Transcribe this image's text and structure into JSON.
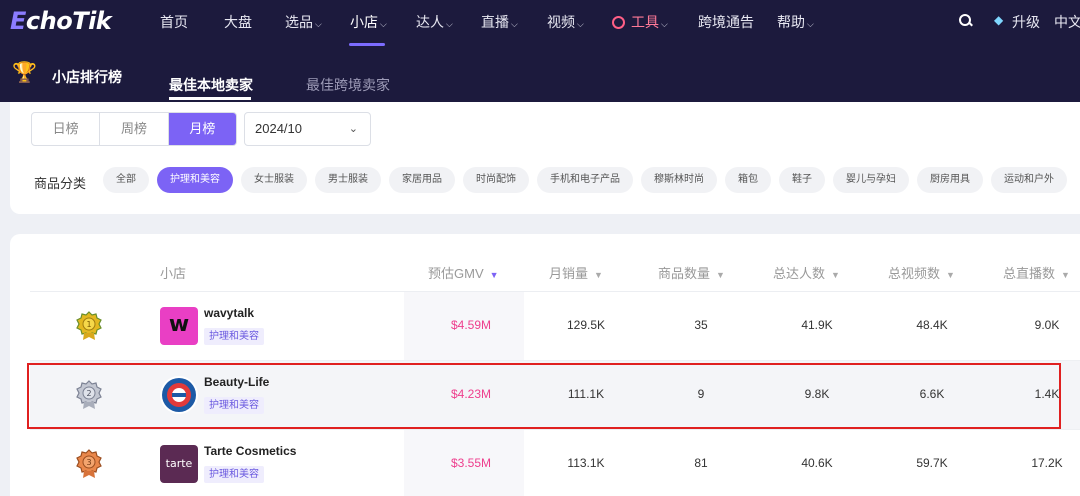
{
  "brand": {
    "logo_e": "E",
    "logo_rest": "choTik"
  },
  "nav": {
    "home": "首页",
    "market": "大盘",
    "products": "选品",
    "shops": "小店",
    "creators": "达人",
    "live": "直播",
    "video": "视频",
    "tools": "工具",
    "crossborder": "跨境通告",
    "help": "帮助",
    "upgrade": "升级",
    "lang": "中文"
  },
  "subnav": {
    "title": "小店排行榜",
    "tab_local": "最佳本地卖家",
    "tab_cross": "最佳跨境卖家"
  },
  "filters": {
    "periods": [
      "日榜",
      "周榜",
      "月榜"
    ],
    "active_period": "月榜",
    "month": "2024/10",
    "category_label": "商品分类",
    "categories": [
      "全部",
      "护理和美容",
      "女士服装",
      "男士服装",
      "家居用品",
      "时尚配饰",
      "手机和电子产品",
      "穆斯林时尚",
      "箱包",
      "鞋子",
      "婴儿与孕妇",
      "厨房用具",
      "运动和户外"
    ],
    "active_category": "护理和美容"
  },
  "table": {
    "headers": {
      "shop": "小店",
      "gmv": "预估GMV",
      "monthly_sales": "月销量",
      "product_count": "商品数量",
      "creators": "总达人数",
      "videos": "总视频数",
      "lives": "总直播数"
    },
    "rows": [
      {
        "name": "wavytalk",
        "tag": "护理和美容",
        "logo_text": "w",
        "gmv": "$4.59M",
        "monthly_sales": "129.5K",
        "product_count": "35",
        "creators": "41.9K",
        "videos": "48.4K",
        "lives": "9.0K"
      },
      {
        "name": "Beauty-Life",
        "tag": "护理和美容",
        "logo_text": "",
        "gmv": "$4.23M",
        "monthly_sales": "111.1K",
        "product_count": "9",
        "creators": "9.8K",
        "videos": "6.6K",
        "lives": "1.4K"
      },
      {
        "name": "Tarte Cosmetics",
        "tag": "护理和美容",
        "logo_text": "tarte",
        "gmv": "$3.55M",
        "monthly_sales": "113.1K",
        "product_count": "81",
        "creators": "40.6K",
        "videos": "59.7K",
        "lives": "17.2K"
      }
    ]
  },
  "colors": {
    "nav_bg": "#1c1a3d",
    "accent": "#7c63f5",
    "gmv": "#ee3e8d",
    "highlight_border": "#e02020",
    "wavytalk_logo": "#e93fc4",
    "tarte_logo": "#5b2a53"
  }
}
